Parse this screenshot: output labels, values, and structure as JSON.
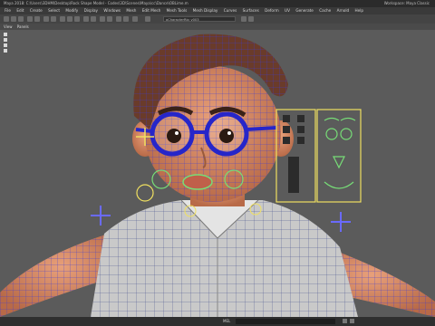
{
  "window": {
    "title": "Maya 2018: C:\\Users\\3DHM\\Desktop\\Rock Shape Model - Codes\\3D\\Scenes\\Maya\\cc\\Dance\\OBLime.m",
    "workspace": "Workspace: Maya Classic"
  },
  "menu": {
    "items": [
      "File",
      "Edit",
      "Create",
      "Select",
      "Modify",
      "Display",
      "Windows",
      "Mesh",
      "Edit Mesh",
      "Mesh Tools",
      "Mesh Display",
      "Curves",
      "Surfaces",
      "Deform",
      "UV",
      "Generate",
      "Cache",
      "Arnold",
      "Help"
    ]
  },
  "toolbar": {
    "field": "oCharacterRig_v003"
  },
  "panel": {
    "items": [
      "View",
      "Panels"
    ]
  },
  "statusbar": {
    "mel_label": "MEL"
  },
  "colors": {
    "viewport_bg": "#5b5b5b",
    "wireframe": "#3b3bd6",
    "control_yellow": "#f0e060",
    "control_green": "#77dd77",
    "control_blue": "#6a6aff"
  }
}
